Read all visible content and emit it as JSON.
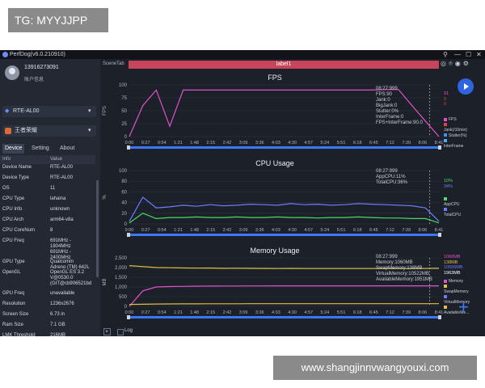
{
  "overlay": {
    "tag": "TG: MYYJJPP",
    "site": "www.shangjinnvwangyouxi.com"
  },
  "window": {
    "title": "PerfDog(v6.0.210910)"
  },
  "profile": {
    "user_id": "13916273091",
    "user_center": "账户信息"
  },
  "device": {
    "name": "RTE-AL00"
  },
  "app": {
    "name": "王者荣耀"
  },
  "tabs": [
    "Device",
    "Setting",
    "About"
  ],
  "info_table": {
    "headers": [
      "Info",
      "Value"
    ],
    "rows": [
      [
        "Device Name",
        "RTE-AL00"
      ],
      [
        "Device Type",
        "RTE-AL00"
      ],
      [
        "OS",
        "11"
      ],
      [
        "CPU Type",
        "lahaina"
      ],
      [
        "CPU Info",
        "unknown"
      ],
      [
        "CPU Arch",
        "arm64-v8a"
      ],
      [
        "CPU CoreNum",
        "8"
      ],
      [
        "CPU Freq",
        "691MHz -\n1804MHz\n691MHz -\n2400MHz"
      ],
      [
        "GPU Type",
        "Qualcomm\nAdreno (TM) 642L"
      ],
      [
        "OpenGL",
        "OpenGL ES 3.2\nV@0530.0\n(GIT@cb906521bd"
      ],
      [
        "GPU Freq",
        "unavailable"
      ],
      [
        "Resolution",
        "1236x2676"
      ],
      [
        "Screen Size",
        "6.73 in"
      ],
      [
        "Ram Size",
        "7.1 GB"
      ],
      [
        "LMK Threshold",
        "216MB"
      ]
    ]
  },
  "main": {
    "scene_tab": "SceneTab",
    "label": "label1",
    "log": "Log"
  },
  "x_ticks": [
    "0:00",
    "0:27",
    "0:54",
    "1:21",
    "1:48",
    "2:15",
    "2:42",
    "3:09",
    "3:36",
    "4:03",
    "4:30",
    "4:57",
    "5:24",
    "5:51",
    "6:18",
    "6:45",
    "7:12",
    "7:39",
    "8:06",
    "8:41"
  ],
  "panels": {
    "fps": {
      "title": "FPS",
      "stats": "08:27:999\nFPS:90\nJank:0\nBigJank:0\nStutter:0%\nInterFrame:0\nFPS+InterFrame:90.0",
      "right_values": [
        {
          "text": "91",
          "color": "#e052c8"
        },
        {
          "text": "0",
          "color": "#e04444"
        },
        {
          "text": "0",
          "color": "#e04444"
        }
      ],
      "legend": [
        {
          "name": "FPS",
          "color": "#e052c8"
        },
        {
          "name": "Jank(/10min)",
          "color": "#e04444"
        },
        {
          "name": "Stutter(%)",
          "color": "#3e8ef0"
        },
        {
          "name": "InterFrame",
          "color": "#44b0f0"
        }
      ]
    },
    "cpu": {
      "title": "CPU Usage",
      "stats": "08:27:999\nAppCPU:11%\nTotalCPU:36%",
      "right_values": [
        {
          "text": "10%",
          "color": "#4cd964"
        },
        {
          "text": "34%",
          "color": "#6c7cff"
        }
      ],
      "legend": [
        {
          "name": "AppCPU",
          "color": "#4cd964"
        },
        {
          "name": "TotalCPU",
          "color": "#6c7cff"
        }
      ]
    },
    "memory": {
      "title": "Memory Usage",
      "stats": "08:27:999\nMemory:1060MB\nSwapMemory:138MB\nVirtualMemory:10522MB\nAvailableMemory:1951MB",
      "right_values": [
        {
          "text": "1060MB",
          "color": "#e052c8"
        },
        {
          "text": "138MB",
          "color": "#e0c040"
        },
        {
          "text": "10506MB",
          "color": "#6c7cff"
        },
        {
          "text": "1963MB",
          "color": "#ffffff"
        }
      ],
      "legend": [
        {
          "name": "Memory",
          "color": "#e052c8"
        },
        {
          "name": "SwapMemory",
          "color": "#e0c040"
        },
        {
          "name": "VirtualMemory",
          "color": "#6c7cff"
        },
        {
          "name": "AvailableMe...",
          "color": "#e0c040"
        }
      ]
    }
  },
  "chart_data": [
    {
      "type": "line",
      "title": "FPS",
      "ylabel": "FPS",
      "ylim": [
        0,
        100
      ],
      "y_ticks": [
        "100",
        "75",
        "50",
        "25",
        "0"
      ],
      "series": [
        {
          "name": "FPS",
          "values": [
            0,
            60,
            90,
            20,
            90,
            90,
            90,
            90,
            90,
            90,
            90,
            90,
            90,
            90,
            90,
            90,
            90,
            90,
            90,
            91,
            91,
            60,
            30,
            0
          ]
        }
      ]
    },
    {
      "type": "line",
      "title": "CPU Usage",
      "ylabel": "%",
      "ylim": [
        0,
        100
      ],
      "y_ticks": [
        "100",
        "80",
        "60",
        "40",
        "20",
        "0"
      ],
      "series": [
        {
          "name": "TotalCPU",
          "values": [
            5,
            50,
            30,
            32,
            35,
            33,
            36,
            34,
            35,
            37,
            36,
            35,
            38,
            36,
            37,
            35,
            36,
            38,
            37,
            36,
            35,
            34,
            30,
            5
          ]
        },
        {
          "name": "AppCPU",
          "values": [
            2,
            20,
            10,
            12,
            12,
            13,
            12,
            12,
            13,
            12,
            12,
            13,
            12,
            12,
            11,
            12,
            12,
            13,
            12,
            11,
            11,
            10,
            10,
            2
          ]
        }
      ]
    },
    {
      "type": "line",
      "title": "Memory Usage",
      "ylabel": "MB",
      "ylim": [
        0,
        2500
      ],
      "y_ticks": [
        "2,500",
        "2,000",
        "1,500",
        "1,000",
        "500",
        "0"
      ],
      "series": [
        {
          "name": "Memory",
          "values": [
            0,
            800,
            1000,
            1020,
            1030,
            1040,
            1045,
            1050,
            1050,
            1055,
            1055,
            1058,
            1060,
            1060,
            1060,
            1060,
            1060,
            1060,
            1060,
            1060,
            1060,
            1060,
            1060,
            1060
          ]
        },
        {
          "name": "AvailableMemory",
          "values": [
            2100,
            2050,
            2000,
            1990,
            1980,
            1970,
            1975,
            1960,
            1965,
            1960,
            1955,
            1950,
            1955,
            1950,
            1952,
            1951,
            1950,
            1952,
            1951,
            1950,
            1951,
            1951,
            1951,
            1963
          ]
        },
        {
          "name": "SwapMemory",
          "values": [
            100,
            110,
            120,
            125,
            130,
            130,
            132,
            134,
            135,
            136,
            136,
            137,
            137,
            138,
            138,
            138,
            138,
            138,
            138,
            138,
            138,
            138,
            138,
            138
          ]
        }
      ]
    }
  ]
}
